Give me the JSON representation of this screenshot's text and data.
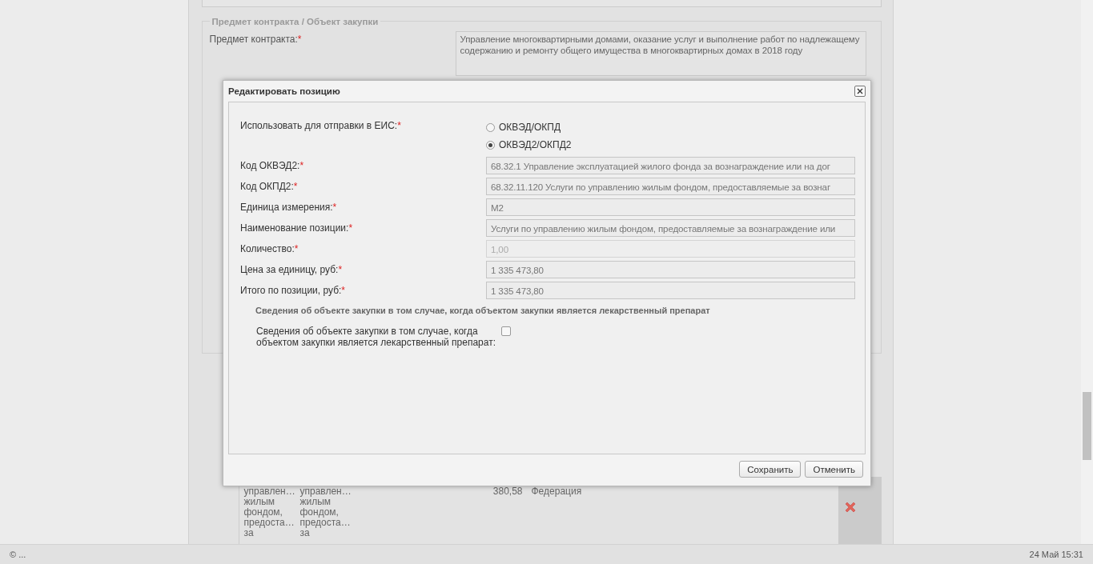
{
  "background": {
    "section_title": "Предмет контракта / Объект закупки",
    "subject_label": "Предмет контракта:",
    "subject_required_mark": "*",
    "subject_value": "Управление многоквартирными домами, оказание услуг и выполнение работ по надлежащему содержанию и ремонту общего имущества в многоквартирных домах в 2018 году",
    "table_row": {
      "cells": [
        "управлен…\nжилым\nфондом,\nпредоста…\nза",
        "управлен…\nжилым\nфондом,\nпредоста…\nза",
        "380,58",
        "Федерация"
      ]
    }
  },
  "dialog": {
    "title": "Редактировать позицию",
    "fields": [
      {
        "kind": "radio",
        "label": "Использовать для отправки в ЕИС:",
        "required_mark": "*",
        "options": [
          {
            "label": "ОКВЭД/ОКПД",
            "selected": false
          },
          {
            "label": "ОКВЭД2/ОКПД2",
            "selected": true
          }
        ]
      },
      {
        "kind": "text",
        "label": "Код ОКВЭД2:",
        "required_mark": "*",
        "value": "68.32.1 Управление эксплуатацией жилого фонда за вознаграждение или на дог",
        "disabled": false
      },
      {
        "kind": "text",
        "label": "Код ОКПД2:",
        "required_mark": "*",
        "value": "68.32.11.120 Услуги по управлению жилым фондом, предоставляемые за вознаг",
        "disabled": false
      },
      {
        "kind": "text",
        "label": "Единица измерения:",
        "required_mark": "*",
        "value": "М2",
        "disabled": false
      },
      {
        "kind": "text",
        "label": "Наименование позиции:",
        "required_mark": "*",
        "value": "Услуги по управлению жилым фондом, предоставляемые за вознаграждение или",
        "disabled": false
      },
      {
        "kind": "text",
        "label": "Количество:",
        "required_mark": "*",
        "value": "1,00",
        "disabled": true
      },
      {
        "kind": "text",
        "label": "Цена за единицу, руб:",
        "required_mark": "*",
        "value": "1 335 473,80",
        "disabled": false
      },
      {
        "kind": "text",
        "label": "Итого по позиции, руб:",
        "required_mark": "*",
        "value": "1 335 473,80",
        "disabled": false
      }
    ],
    "section_heading": "Сведения об объекте закупки в том случае, когда объектом закупки является лекарственный препарат",
    "checkbox": {
      "label": "Сведения об объекте закупки в том случае, когда объектом закупки является лекарственный препарат:",
      "checked": false
    },
    "buttons": [
      "Сохранить",
      "Отменить"
    ]
  },
  "status_bar": {
    "left": "© ...",
    "right": "24 Май 15:31"
  }
}
